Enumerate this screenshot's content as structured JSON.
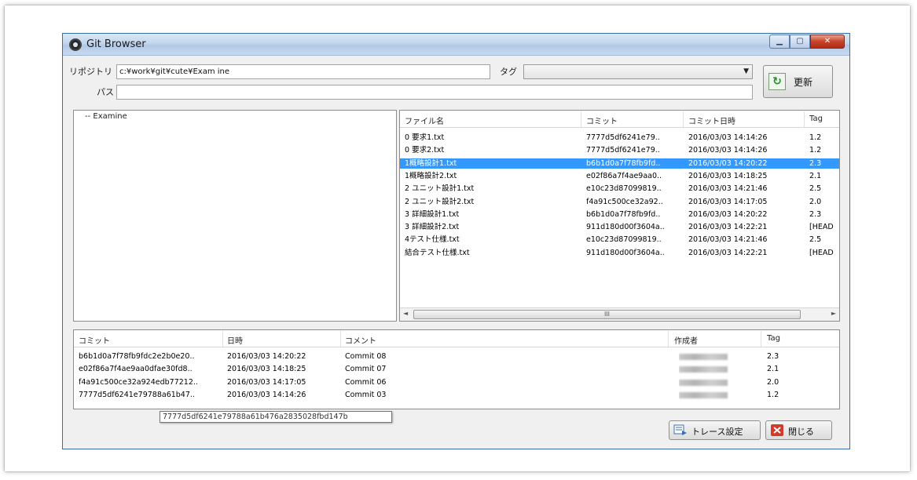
{
  "window": {
    "title": "Git Browser",
    "minimize_icon": "minimize-icon",
    "maximize_icon": "maximize-icon",
    "close_icon": "close-icon"
  },
  "form": {
    "repository_label": "リポジトリ",
    "repository_value": "c:¥work¥git¥cute¥Exam ine",
    "path_label": "パス",
    "path_value": "",
    "tag_label": "タグ",
    "tag_value": "",
    "refresh_label": "更新",
    "refresh_icon": "refresh-icon"
  },
  "tree": {
    "items": [
      "-- Examine"
    ]
  },
  "files": {
    "columns": [
      "ファイル名",
      "コミット",
      "コミット日時",
      "Tag"
    ],
    "rows": [
      {
        "name": "0 要求1.txt",
        "commit": "7777d5df6241e79..",
        "date": "2016/03/03 14:14:26",
        "tag": "1.2",
        "selected": false
      },
      {
        "name": "0 要求2.txt",
        "commit": "7777d5df6241e79..",
        "date": "2016/03/03 14:14:26",
        "tag": "1.2",
        "selected": false
      },
      {
        "name": "1概略設計1.txt",
        "commit": "b6b1d0a7f78fb9fd..",
        "date": "2016/03/03 14:20:22",
        "tag": "2.3",
        "selected": true
      },
      {
        "name": "1概略設計2.txt",
        "commit": "e02f86a7f4ae9aa0..",
        "date": "2016/03/03 14:18:25",
        "tag": "2.1",
        "selected": false
      },
      {
        "name": "2 ユニット設計1.txt",
        "commit": "e10c23d87099819..",
        "date": "2016/03/03 14:21:46",
        "tag": "2.5",
        "selected": false
      },
      {
        "name": "2 ユニット設計2.txt",
        "commit": "f4a91c500ce32a92..",
        "date": "2016/03/03 14:17:05",
        "tag": "2.0",
        "selected": false
      },
      {
        "name": "3 詳細設計1.txt",
        "commit": "b6b1d0a7f78fb9fd..",
        "date": "2016/03/03 14:20:22",
        "tag": "2.3",
        "selected": false
      },
      {
        "name": "3 詳細設計2.txt",
        "commit": "911d180d00f3604a..",
        "date": "2016/03/03 14:22:21",
        "tag": "[HEAD",
        "selected": false
      },
      {
        "name": "4テスト仕様.txt",
        "commit": "e10c23d87099819..",
        "date": "2016/03/03 14:21:46",
        "tag": "2.5",
        "selected": false
      },
      {
        "name": "結合テスト仕様.txt",
        "commit": "911d180d00f3604a..",
        "date": "2016/03/03 14:22:21",
        "tag": "[HEAD",
        "selected": false
      }
    ],
    "scroll_thumb_label": "III"
  },
  "commits": {
    "columns": [
      "コミット",
      "日時",
      "コメント",
      "作成者",
      "Tag"
    ],
    "rows": [
      {
        "commit": "b6b1d0a7f78fb9fdc2e2b0e20..",
        "date": "2016/03/03 14:20:22",
        "comment": "Commit 08",
        "tag": "2.3"
      },
      {
        "commit": "e02f86a7f4ae9aa0dfae30fd8..",
        "date": "2016/03/03 14:18:25",
        "comment": "Commit 07",
        "tag": "2.1"
      },
      {
        "commit": "f4a91c500ce32a924edb77212..",
        "date": "2016/03/03 14:17:05",
        "comment": "Commit 06",
        "tag": "2.0"
      },
      {
        "commit": "7777d5df6241e79788a61b47..",
        "date": "2016/03/03 14:14:26",
        "comment": "Commit 03",
        "tag": "1.2"
      }
    ]
  },
  "tooltip": {
    "text": "7777d5df6241e79788a61b476a2835028fbd147b"
  },
  "footer": {
    "trace_label": "トレース設定",
    "close_label": "閉じる"
  },
  "colors": {
    "selection": "#3399ff",
    "titlebar": "#c3d6ee",
    "close_button": "#c7432a"
  }
}
